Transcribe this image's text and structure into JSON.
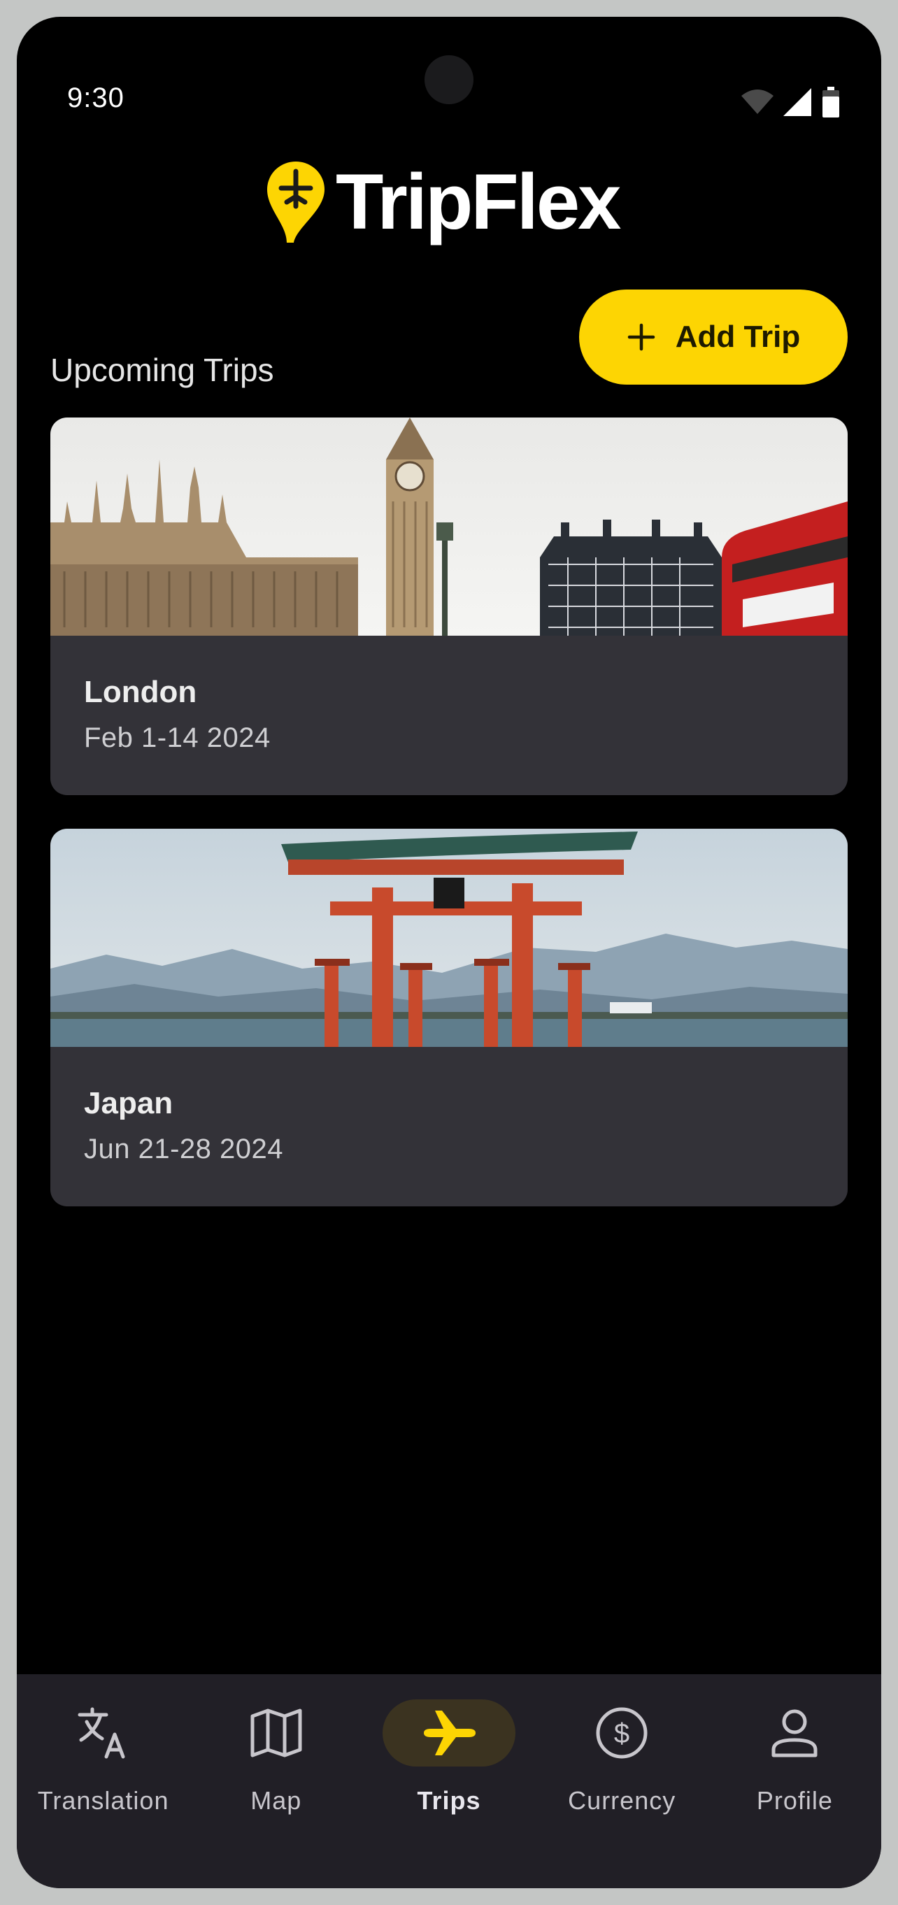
{
  "status_bar": {
    "time": "9:30",
    "icons": [
      "wifi-icon",
      "signal-icon",
      "battery-icon"
    ]
  },
  "app": {
    "name": "TripFlex",
    "logo_icon": "location-pin-plane-icon",
    "accent_color": "#fdd503"
  },
  "trips_section": {
    "title": "Upcoming Trips",
    "add_button": {
      "label": "Add Trip",
      "icon": "plus-icon"
    }
  },
  "trips": [
    {
      "destination": "London",
      "dates": "Feb 1-14 2024",
      "image": "london-skyline-photo"
    },
    {
      "destination": "Japan",
      "dates": "Jun 21-28 2024",
      "image": "torii-gate-photo"
    }
  ],
  "bottom_nav": {
    "items": [
      {
        "label": "Translation",
        "icon": "translate-icon",
        "active": false
      },
      {
        "label": "Map",
        "icon": "map-icon",
        "active": false
      },
      {
        "label": "Trips",
        "icon": "airplane-icon",
        "active": true
      },
      {
        "label": "Currency",
        "icon": "dollar-circle-icon",
        "active": false
      },
      {
        "label": "Profile",
        "icon": "person-icon",
        "active": false
      }
    ]
  }
}
